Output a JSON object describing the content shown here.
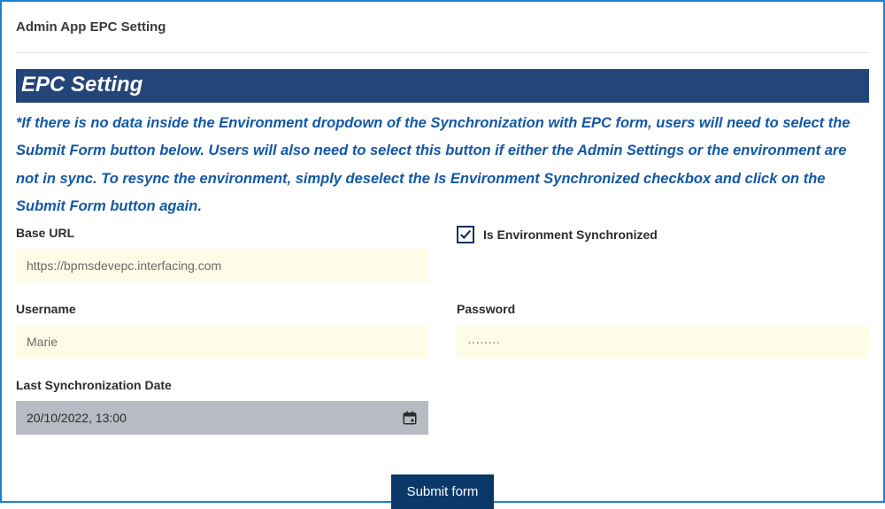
{
  "page": {
    "title": "Admin App EPC Setting"
  },
  "section": {
    "header": "EPC Setting",
    "helper_text": "*If there is no data inside the Environment dropdown of the Synchronization with EPC form, users will need to select the Submit Form button below. Users will also need to select this button if either the Admin Settings or the environment are not in sync. To resync the environment, simply deselect the Is Environment Synchronized checkbox and click on the Submit Form button again."
  },
  "form": {
    "base_url": {
      "label": "Base URL",
      "value": "https://bpmsdevepc.interfacing.com"
    },
    "env_sync": {
      "label": "Is Environment Synchronized",
      "checked": true
    },
    "username": {
      "label": "Username",
      "value": "Marie"
    },
    "password": {
      "label": "Password",
      "value": "········"
    },
    "last_sync": {
      "label": "Last Synchronization Date",
      "value": "20/10/2022, 13:00"
    },
    "submit_label": "Submit form"
  }
}
